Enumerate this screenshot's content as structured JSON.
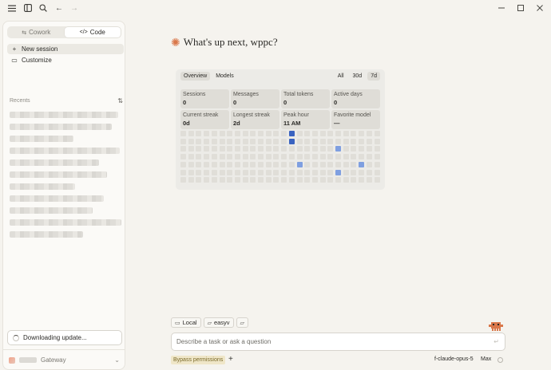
{
  "sidebar": {
    "modes": [
      {
        "label": "Cowork",
        "icon": "cowork-icon",
        "active": false
      },
      {
        "label": "Code",
        "icon": "code-icon",
        "active": true
      }
    ],
    "new_session": "New session",
    "customize": "Customize",
    "recents_label": "Recents",
    "update_status": "Downloading update...",
    "account_name": "Gateway"
  },
  "main": {
    "greeting": "What's up next, wppc?",
    "stats": {
      "tabs": [
        "Overview",
        "Models"
      ],
      "ranges": [
        "All",
        "30d",
        "7d"
      ],
      "active_range": "7d",
      "cards": [
        {
          "label": "Sessions",
          "value": "0"
        },
        {
          "label": "Messages",
          "value": "0"
        },
        {
          "label": "Total tokens",
          "value": "0"
        },
        {
          "label": "Active days",
          "value": "0"
        },
        {
          "label": "Current streak",
          "value": "0d"
        },
        {
          "label": "Longest streak",
          "value": "2d"
        },
        {
          "label": "Peak hour",
          "value": "11 AM"
        },
        {
          "label": "Favorite model",
          "value": "—"
        }
      ],
      "activity": {
        "columns": 26,
        "rows": 7,
        "active_cells": [
          {
            "col": 14,
            "row": 0,
            "level": 3
          },
          {
            "col": 14,
            "row": 1,
            "level": 3
          },
          {
            "col": 20,
            "row": 2,
            "level": 1
          },
          {
            "col": 15,
            "row": 4,
            "level": 1
          },
          {
            "col": 23,
            "row": 4,
            "level": 1
          },
          {
            "col": 20,
            "row": 5,
            "level": 1
          }
        ],
        "colors": {
          "empty": "#e0ded8",
          "level1": "#7f9fe0",
          "level3": "#3a63c0"
        }
      }
    }
  },
  "composer": {
    "chips": [
      {
        "label": "Local",
        "icon": "laptop-icon"
      },
      {
        "label": "easyv",
        "icon": "folder-icon"
      },
      {
        "label": "",
        "icon": "folder-add-icon"
      }
    ],
    "placeholder": "Describe a task or ask a question",
    "permission_mode": "Bypass permissions",
    "model": "f-claude-opus-5",
    "effort": "Max"
  }
}
